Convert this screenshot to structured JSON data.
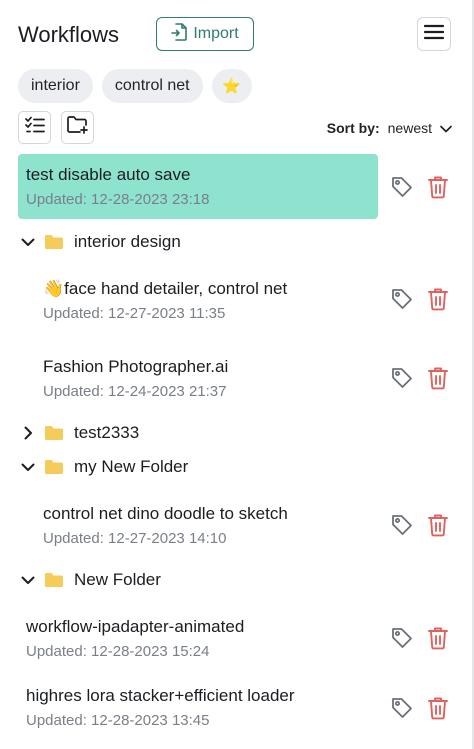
{
  "header": {
    "title": "Workflows",
    "import_label": "Import",
    "menu_icon": "hamburger-menu-icon"
  },
  "tags": [
    "interior",
    "control net",
    "⭐"
  ],
  "toolbar": {
    "multi_select_icon": "checklist-icon",
    "new_folder_icon": "folder-plus-icon",
    "sort_label": "Sort by:",
    "sort_value": "newest"
  },
  "items": [
    {
      "title": "test disable auto save",
      "date": "Updated: 12-28-2023 23:18",
      "selected": true
    },
    {
      "title": "👋face hand detailer, control net",
      "date": "Updated: 12-27-2023 11:35"
    },
    {
      "title": "Fashion Photographer.ai",
      "date": "Updated: 12-24-2023 21:37"
    },
    {
      "title": "control net dino doodle to sketch",
      "date": "Updated: 12-27-2023 14:10"
    },
    {
      "title": "workflow-ipadapter-animated",
      "date": "Updated: 12-28-2023 15:24"
    },
    {
      "title": "highres lora stacker+efficient loader",
      "date": "Updated: 12-28-2023 13:45"
    }
  ],
  "folders": [
    {
      "name": "interior design",
      "expanded": true
    },
    {
      "name": "test2333",
      "expanded": false
    },
    {
      "name": "my New Folder",
      "expanded": true
    },
    {
      "name": "New Folder",
      "expanded": true
    }
  ],
  "colors": {
    "accent": "#2f7d6d",
    "selected_bg": "#8ee3cf",
    "folder": "#f5cc5a",
    "delete": "#e0625e",
    "tag_icon": "#6b7078"
  }
}
